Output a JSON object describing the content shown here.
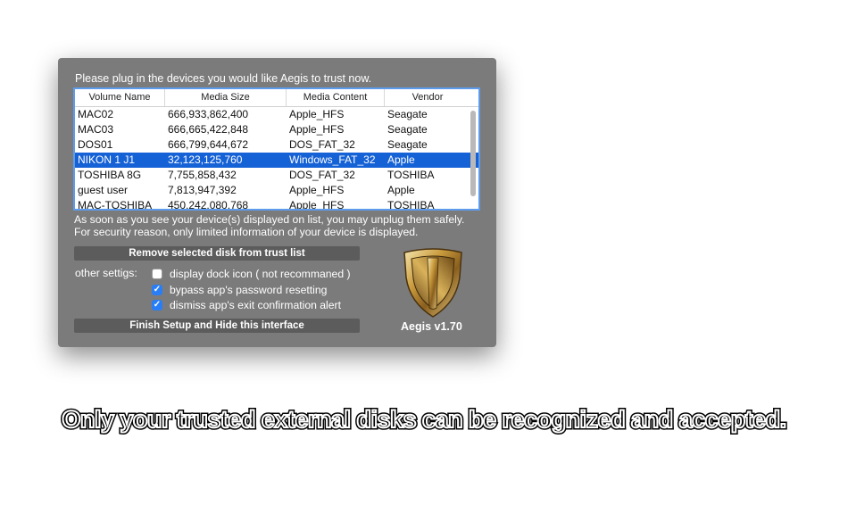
{
  "panel": {
    "instruction": "Please plug in the devices you would like Aegis to trust now.",
    "table": {
      "headers": [
        "Volume Name",
        "Media Size",
        "Media Content",
        "Vendor"
      ],
      "rows": [
        [
          "MAC02",
          "666,933,862,400",
          "Apple_HFS",
          "Seagate"
        ],
        [
          "MAC03",
          "666,665,422,848",
          "Apple_HFS",
          "Seagate"
        ],
        [
          "DOS01",
          "666,799,644,672",
          "DOS_FAT_32",
          "Seagate"
        ],
        [
          "NIKON 1 J1",
          "32,123,125,760",
          "Windows_FAT_32",
          "Apple"
        ],
        [
          "TOSHIBA 8G",
          "7,755,858,432",
          "DOS_FAT_32",
          "TOSHIBA"
        ],
        [
          "guest user",
          "7,813,947,392",
          "Apple_HFS",
          "Apple"
        ],
        [
          "MAC-TOSHIBA",
          "450,242,080,768",
          "Apple_HFS",
          "TOSHIBA"
        ]
      ],
      "selected_row": 3
    },
    "note_line1": "As soon as you see your device(s) displayed on list, you may unplug them safely.",
    "note_line2": "For security reason, only limited information of your device is displayed.",
    "remove_button": "Remove selected disk from trust list",
    "other_settings_label": "other settigs:",
    "options": [
      {
        "label": "display dock icon ( not recommaned )",
        "checked": false
      },
      {
        "label": "bypass app's password resetting",
        "checked": true
      },
      {
        "label": "dismiss app's exit confirmation alert",
        "checked": true
      }
    ],
    "finish_button": "Finish Setup and Hide this interface",
    "version": "Aegis v1.70"
  },
  "caption": "Only your trusted external disks can be recognized and accepted.",
  "colors": {
    "panel_bg": "#7b7b7b",
    "selection": "#1561d6",
    "button_bg": "#5c5c5c",
    "checkbox_on": "#2a7ef5",
    "table_border": "#5d9cec"
  }
}
